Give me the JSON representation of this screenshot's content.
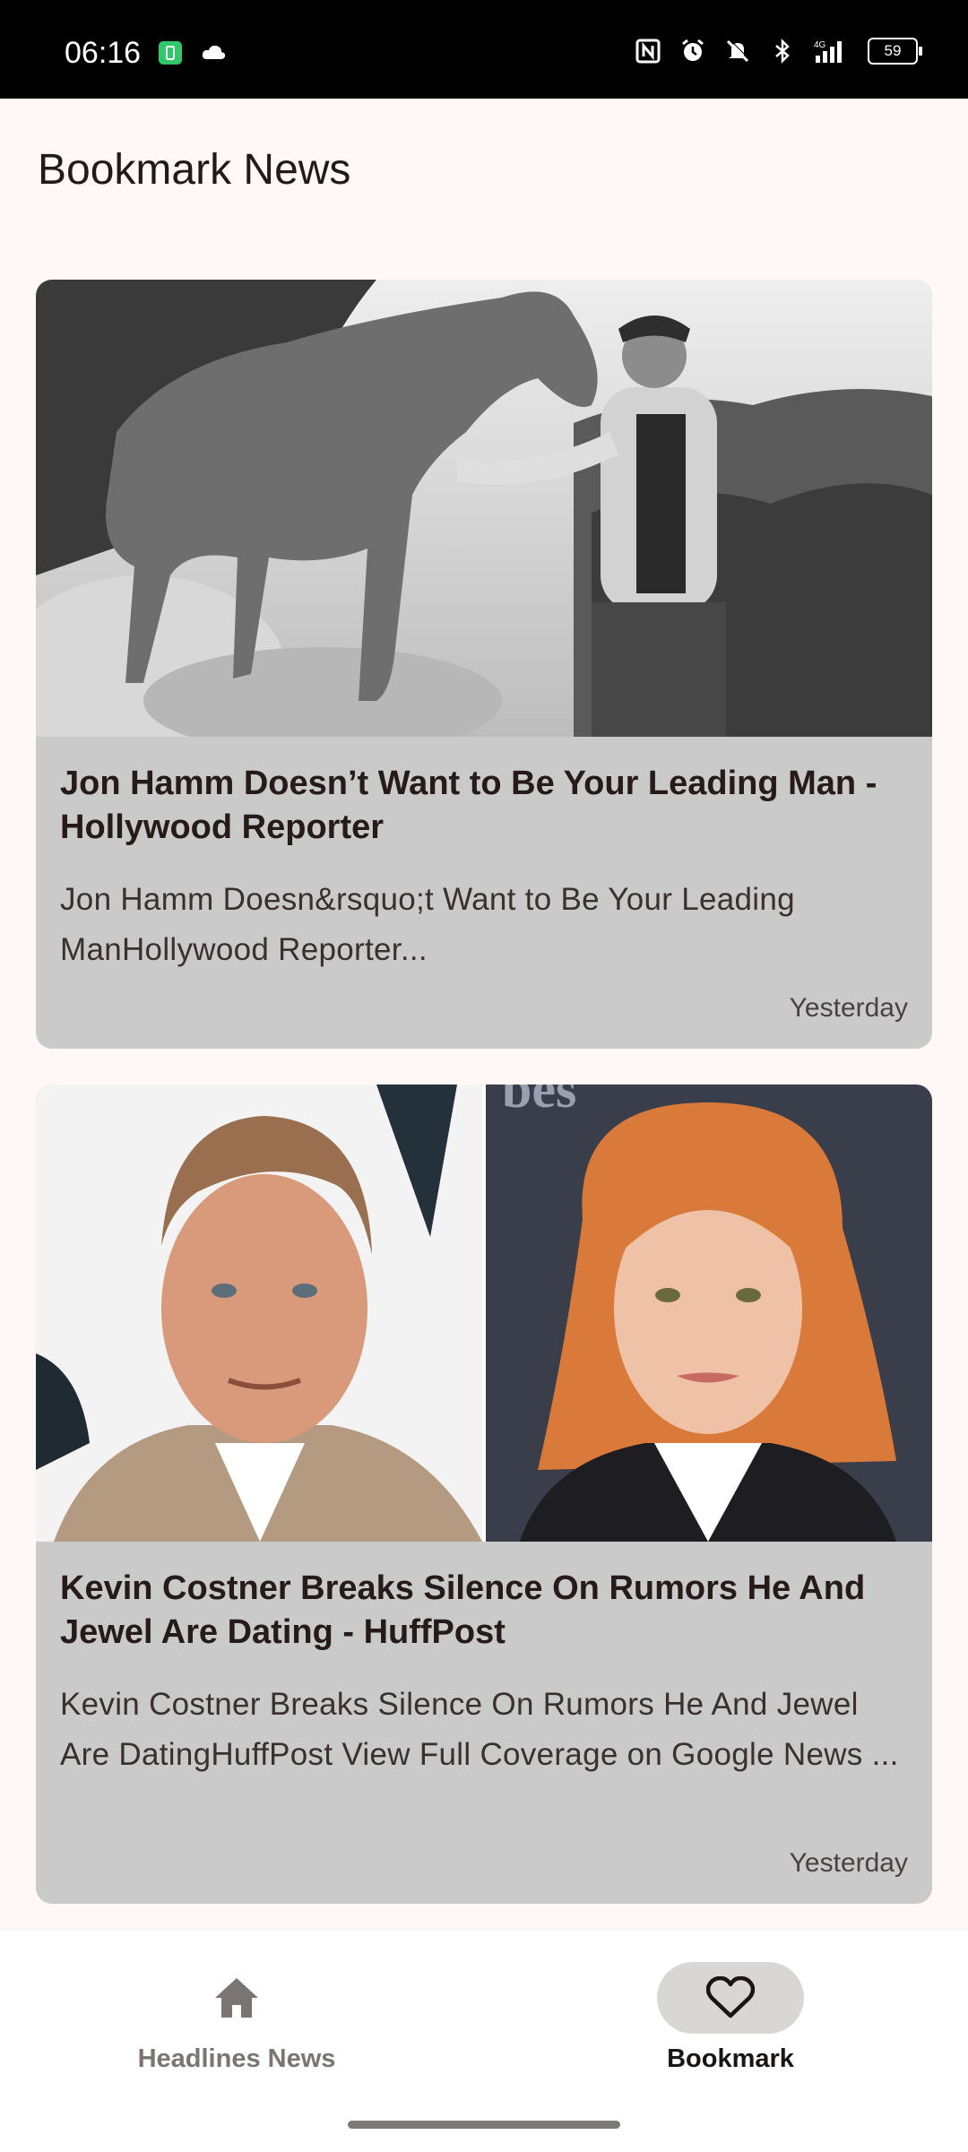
{
  "status_bar": {
    "time": "06:16",
    "battery": "59",
    "network": "4G",
    "left_icons": [
      "battery-saver-icon",
      "cloud-icon"
    ],
    "right_icons": [
      "nfc-icon",
      "alarm-icon",
      "mute-icon",
      "bluetooth-icon",
      "signal-icon",
      "battery-icon"
    ]
  },
  "page": {
    "title": "Bookmark News"
  },
  "articles": [
    {
      "title": "Jon Hamm Doesn’t Want to Be Your Leading Man - Hollywood Reporter",
      "description": "Jon Hamm Doesn&rsquo;t Want to Be Your Leading ManHollywood Reporter...",
      "time": "Yesterday",
      "image_alt": "Black and white photo of a man standing beside a horse on a hillside"
    },
    {
      "title": "Kevin Costner Breaks Silence On Rumors He And Jewel Are Dating - HuffPost",
      "description": "Kevin Costner Breaks Silence On Rumors He And Jewel Are DatingHuffPost View Full Coverage on Google News ...",
      "time": "Yesterday",
      "image_alt": "Split portrait of a man in a tan jacket and a woman with red hair"
    }
  ],
  "bottom_nav": {
    "items": [
      {
        "label": "Headlines News",
        "icon": "home-icon",
        "selected": false
      },
      {
        "label": "Bookmark",
        "icon": "heart-icon",
        "selected": true
      }
    ]
  },
  "colors": {
    "background": "#fff8f6",
    "card": "#cacaca",
    "selected_pill": "#d9d6d6"
  }
}
